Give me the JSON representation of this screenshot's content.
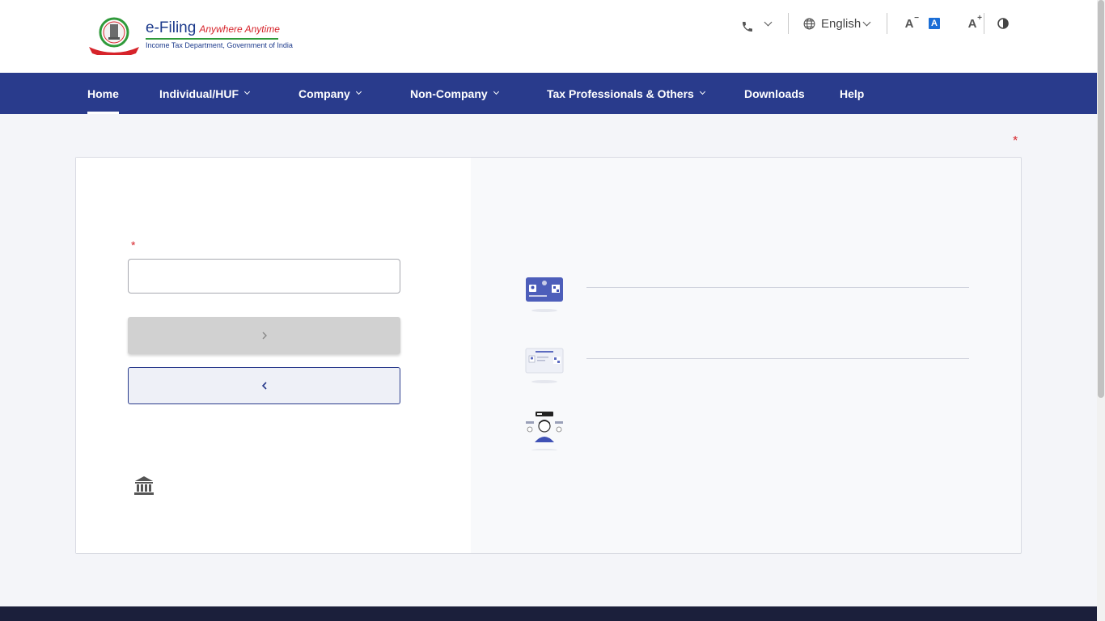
{
  "header": {
    "brand_title": "e-Filing",
    "brand_tagline": "Anywhere Anytime",
    "brand_subtitle": "Income Tax Department, Government of India",
    "language": "English",
    "font_decrease": "A",
    "font_normal": "A",
    "font_increase": "A"
  },
  "nav": {
    "items": [
      {
        "label": "Home",
        "active": true,
        "has_dropdown": false
      },
      {
        "label": "Individual/HUF",
        "active": false,
        "has_dropdown": true
      },
      {
        "label": "Company",
        "active": false,
        "has_dropdown": true
      },
      {
        "label": "Non-Company",
        "active": false,
        "has_dropdown": true
      },
      {
        "label": "Tax Professionals & Others",
        "active": false,
        "has_dropdown": true
      },
      {
        "label": "Downloads",
        "active": false,
        "has_dropdown": false
      },
      {
        "label": "Help",
        "active": false,
        "has_dropdown": false
      }
    ]
  },
  "form": {
    "required_mark": "*",
    "input_value": "",
    "continue_icon": "chevron-right-icon",
    "back_icon": "chevron-left-icon"
  },
  "options": [
    {
      "icon": "pan-card-icon"
    },
    {
      "icon": "id-document-icon"
    },
    {
      "icon": "person-representative-icon"
    }
  ],
  "icons": {
    "phone": "phone-icon",
    "globe": "globe-icon",
    "contrast": "contrast-icon",
    "bank": "bank-icon"
  },
  "colors": {
    "nav_bg": "#293b8c",
    "required": "#d6232a",
    "footer_bg": "#1b1f3b",
    "accent_blue": "#1b6ed6"
  }
}
